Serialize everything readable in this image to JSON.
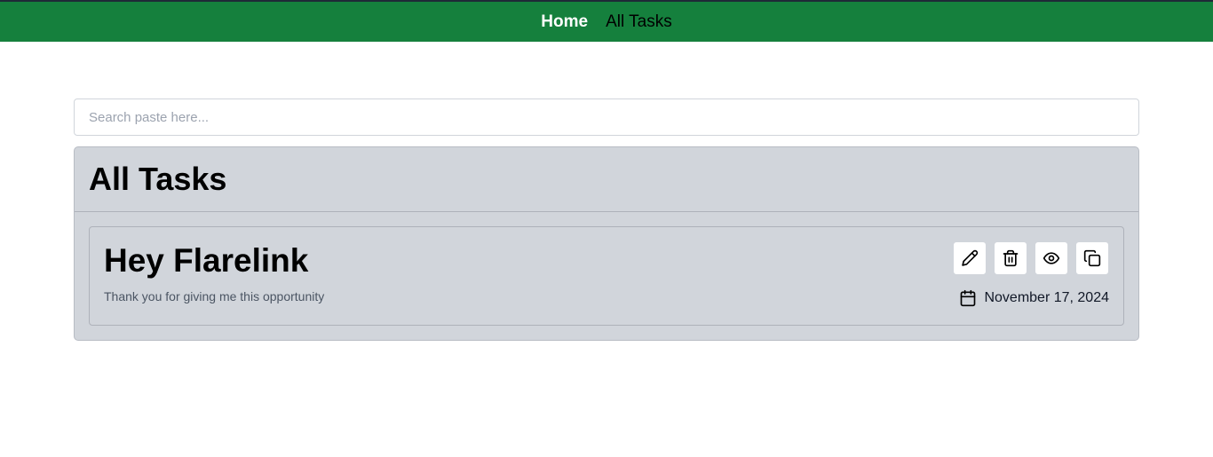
{
  "nav": {
    "home_label": "Home",
    "all_tasks_label": "All Tasks",
    "bg_color": "#15803d"
  },
  "search": {
    "placeholder": "Search paste here...",
    "value": ""
  },
  "tasks_panel": {
    "heading": "All Tasks",
    "items": [
      {
        "title": "Hey Flarelink",
        "description": "Thank you for giving me this opportunity",
        "date": "November 17, 2024",
        "actions": [
          {
            "icon": "pencil-icon"
          },
          {
            "icon": "trash-icon"
          },
          {
            "icon": "eye-icon"
          },
          {
            "icon": "copy-icon"
          }
        ]
      }
    ]
  },
  "colors": {
    "panel_bg": "#d1d5db",
    "button_bg": "#ffffff",
    "description_text": "#4b5563"
  }
}
